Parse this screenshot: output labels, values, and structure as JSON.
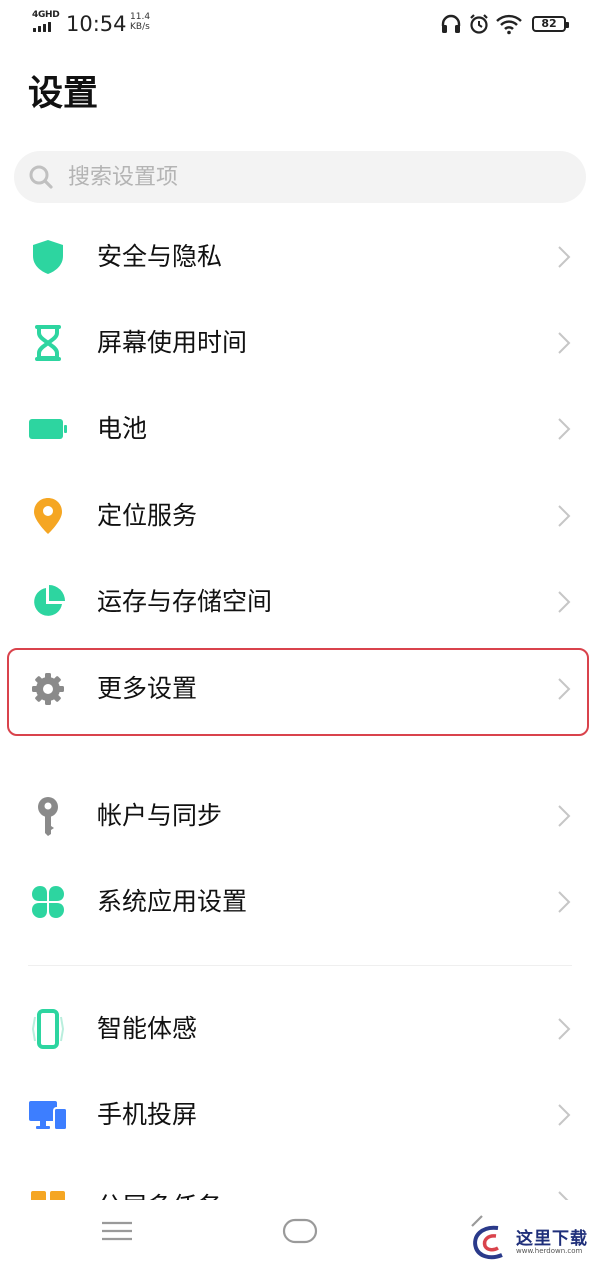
{
  "status_bar": {
    "network": "4GHD",
    "time": "10:54",
    "speed_value": "11.4",
    "speed_unit": "KB/s",
    "battery": "82",
    "icons": [
      "headset-icon",
      "alarm-icon",
      "wifi-icon",
      "battery-icon"
    ]
  },
  "page": {
    "title": "设置"
  },
  "search": {
    "placeholder": "搜索设置项",
    "value": ""
  },
  "items": [
    {
      "label": "安全与隐私",
      "icon": "shield-icon",
      "color": "#2dd5a0"
    },
    {
      "label": "屏幕使用时间",
      "icon": "hourglass-icon",
      "color": "#2dd5a0"
    },
    {
      "label": "电池",
      "icon": "battery-icon",
      "color": "#2dd5a0"
    },
    {
      "label": "定位服务",
      "icon": "location-pin-icon",
      "color": "#f5a623"
    },
    {
      "label": "运存与存储空间",
      "icon": "pie-chart-icon",
      "color": "#2dd5a0"
    },
    {
      "label": "更多设置",
      "icon": "gear-icon",
      "color": "#8a8a8a"
    },
    {
      "label": "帐户与同步",
      "icon": "key-icon",
      "color": "#8a8a8a"
    },
    {
      "label": "系统应用设置",
      "icon": "apps-clover-icon",
      "color": "#2dd5a0"
    },
    {
      "label": "智能体感",
      "icon": "phone-vibrate-icon",
      "color": "#2dd5a0"
    },
    {
      "label": "手机投屏",
      "icon": "screen-cast-icon",
      "color": "#3d7eff"
    },
    {
      "label": "分屏多任务",
      "icon": "split-screen-icon",
      "color": "#f5a623"
    }
  ],
  "highlight_color": "#d9434c",
  "watermark": {
    "text": "这里下载",
    "url_text": "www.herdown.com"
  }
}
